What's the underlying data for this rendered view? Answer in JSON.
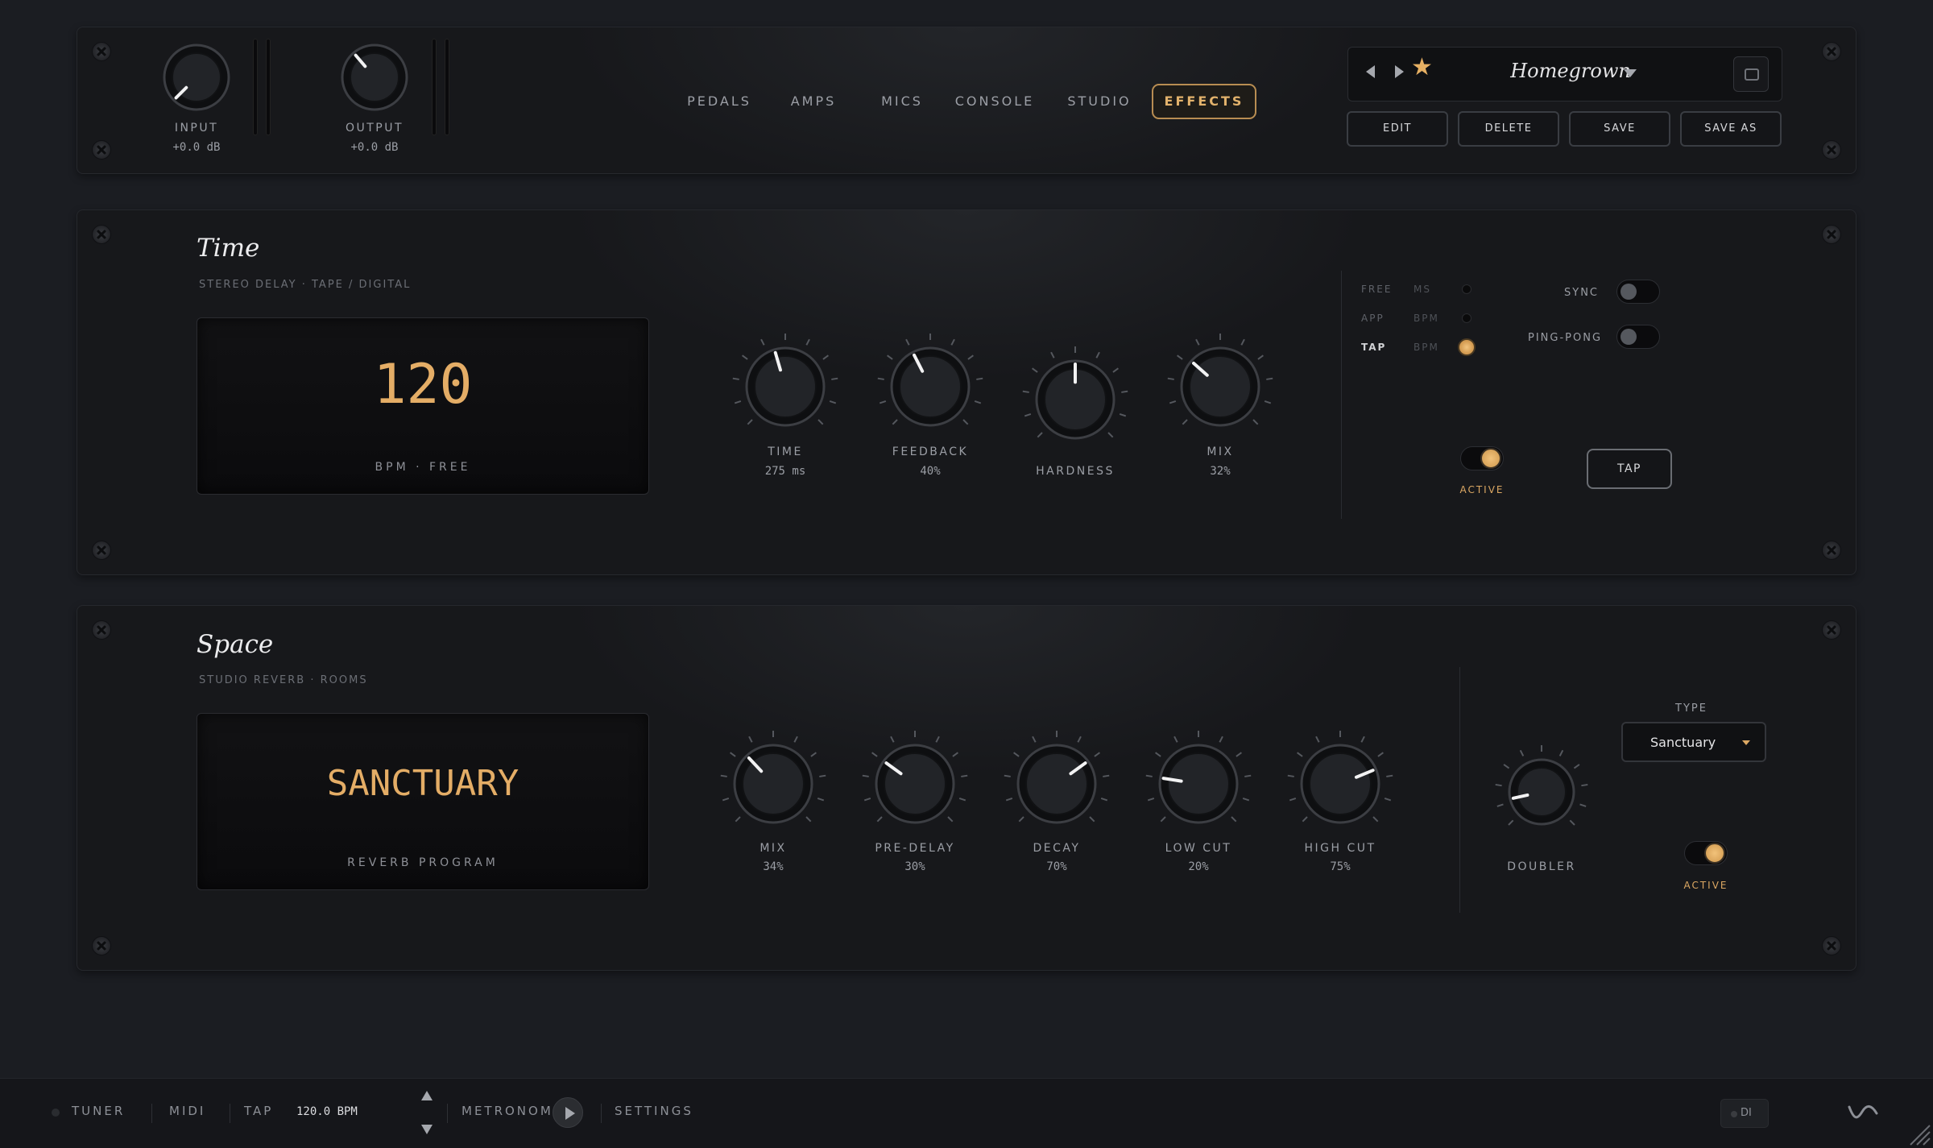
{
  "header": {
    "input": {
      "label": "INPUT",
      "value": "+0.0 dB",
      "level": 0
    },
    "output": {
      "label": "OUTPUT",
      "value": "+0.0 dB",
      "level": 0.35
    },
    "tabs": [
      {
        "label": "PEDALS",
        "active": false
      },
      {
        "label": "AMPS",
        "active": false
      },
      {
        "label": "MICS",
        "active": false
      },
      {
        "label": "CONSOLE",
        "active": false
      },
      {
        "label": "STUDIO",
        "active": false
      },
      {
        "label": "EFFECTS",
        "active": true
      }
    ],
    "preset": {
      "name": "Homegrown",
      "favorite": true,
      "buttons": {
        "edit": "EDIT",
        "delete": "DELETE",
        "save": "SAVE",
        "save_as": "SAVE AS"
      }
    }
  },
  "time": {
    "title": "Time",
    "subtitle": "STEREO DELAY · TAPE / DIGITAL",
    "display": {
      "value": "120",
      "caption": "BPM · FREE"
    },
    "knobs": [
      {
        "label": "TIME",
        "value": "275 ms",
        "level": 0.44
      },
      {
        "label": "FEEDBACK",
        "value": "40%",
        "level": 0.4
      },
      {
        "label": "HARDNESS",
        "value": "",
        "level": 0.5
      },
      {
        "label": "MIX",
        "value": "32%",
        "level": 0.32
      }
    ],
    "modes": [
      {
        "label": "FREE",
        "unit": "MS",
        "on": false
      },
      {
        "label": "APP",
        "unit": "BPM",
        "on": false
      },
      {
        "label": "TAP",
        "unit": "BPM",
        "on": true
      }
    ],
    "sync": {
      "label": "SYNC",
      "on": false
    },
    "pingpong": {
      "label": "PING-PONG",
      "on": false
    },
    "active": {
      "label": "ACTIVE",
      "on": true
    },
    "tap_label": "TAP"
  },
  "space": {
    "title": "Space",
    "subtitle": "STUDIO REVERB · ROOMS",
    "display": {
      "value": "SANCTUARY",
      "caption": "REVERB PROGRAM"
    },
    "knobs": [
      {
        "label": "MIX",
        "value": "34%",
        "level": 0.34
      },
      {
        "label": "PRE-DELAY",
        "value": "30%",
        "level": 0.3
      },
      {
        "label": "DECAY",
        "value": "70%",
        "level": 0.7
      },
      {
        "label": "LOW CUT",
        "value": "20%",
        "level": 0.2
      },
      {
        "label": "HIGH CUT",
        "value": "75%",
        "level": 0.75
      }
    ],
    "doubler": {
      "label": "DOUBLER",
      "level": 0.12
    },
    "type": {
      "label": "TYPE",
      "value": "Sanctuary"
    },
    "active": {
      "label": "ACTIVE",
      "on": true
    }
  },
  "bottom": {
    "tuner": "TUNER",
    "midi": "MIDI",
    "tap": "TAP",
    "bpm": "120.0 BPM",
    "metronome": "METRONOME",
    "settings": "SETTINGS",
    "di": "DI"
  },
  "colors": {
    "accent": "#dca863",
    "background": "#1b1d22"
  }
}
